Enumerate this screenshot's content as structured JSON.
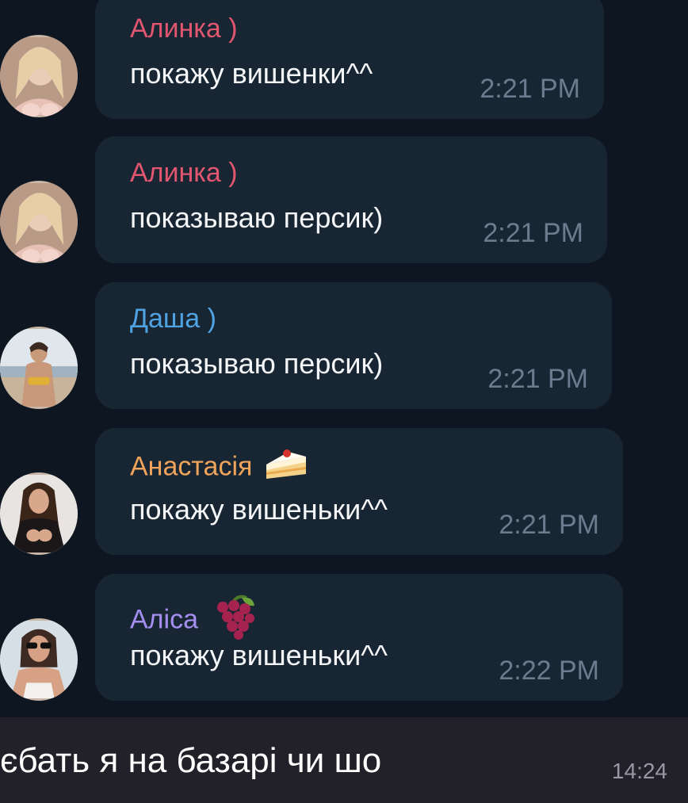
{
  "chat": {
    "messages": [
      {
        "sender": "Алинка )",
        "text": "покажу вишенки^^",
        "time": "2:21 PM",
        "sender_color": "#e2566f",
        "avatar": "avatar-photo"
      },
      {
        "sender": "Алинка )",
        "text": "показываю персик)",
        "time": "2:21 PM",
        "sender_color": "#e2566f",
        "avatar": "avatar-photo"
      },
      {
        "sender": "Даша )",
        "text": "показываю персик)",
        "time": "2:21 PM",
        "sender_color": "#4fa3e3",
        "avatar": "avatar-photo"
      },
      {
        "sender": "Анастасія",
        "text": "покажу вишеньки^^",
        "time": "2:21 PM",
        "sender_color": "#f0a35a",
        "emoji": "cake-icon",
        "avatar": "avatar-photo"
      },
      {
        "sender": "Аліса",
        "text": "покажу вишеньки^^",
        "time": "2:22 PM",
        "sender_color": "#a48ff0",
        "emoji": "grapes-icon",
        "avatar": "avatar-photo"
      }
    ]
  },
  "reply": {
    "text": "єбать я на базарі чи шо",
    "time": "14:24"
  },
  "colors": {
    "background": "#0e1621",
    "bubble": "#182533",
    "message_text": "#f4f6f8",
    "time_text": "#6b7c8f",
    "reply_background": "#222129"
  }
}
